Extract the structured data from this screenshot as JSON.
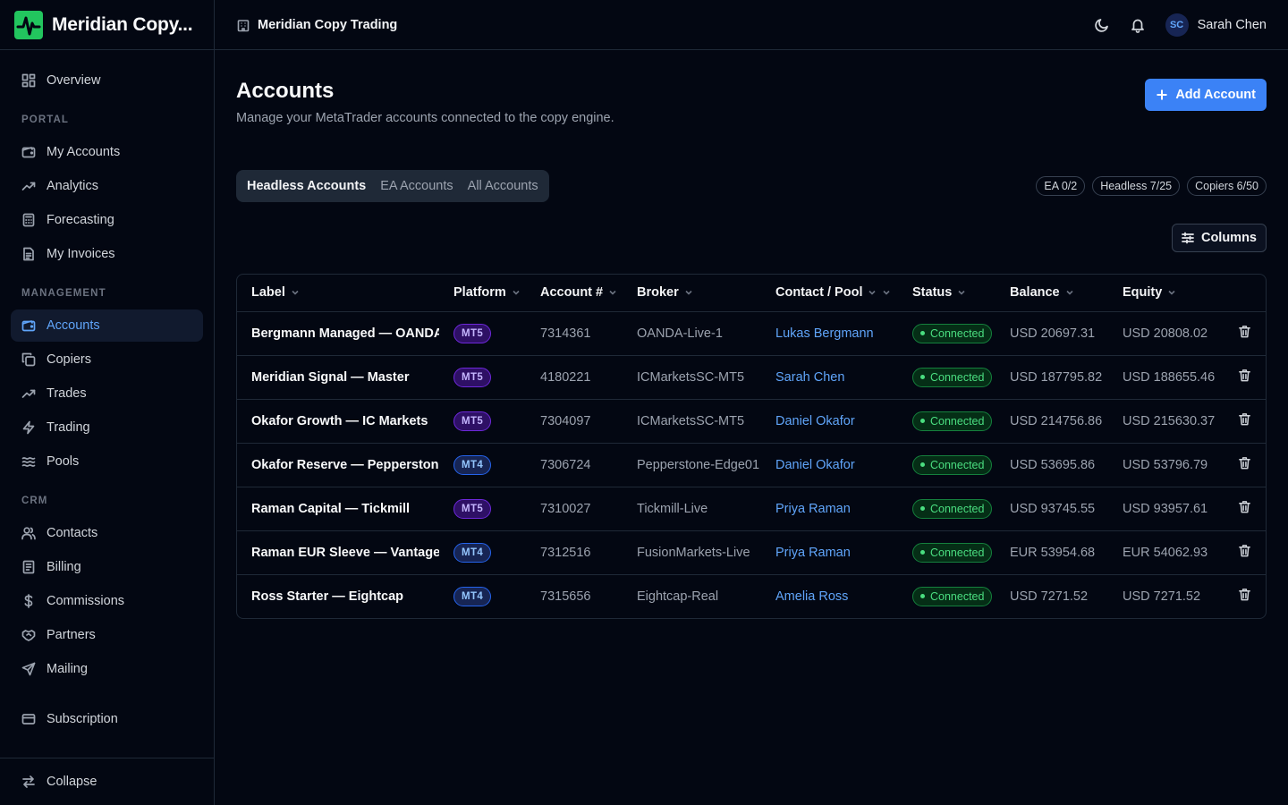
{
  "brand": {
    "name": "Meridian Copy...",
    "accent": "#22c55e"
  },
  "sidebar": {
    "overview": "Overview",
    "sections": {
      "portal": "PORTAL",
      "management": "MANAGEMENT",
      "crm": "CRM"
    },
    "portal_items": [
      {
        "label": "My Accounts",
        "icon": "wallet-icon"
      },
      {
        "label": "Analytics",
        "icon": "trend-icon"
      },
      {
        "label": "Forecasting",
        "icon": "calculator-icon"
      },
      {
        "label": "My Invoices",
        "icon": "file-icon"
      }
    ],
    "management_items": [
      {
        "label": "Accounts",
        "icon": "wallet-icon",
        "active": true
      },
      {
        "label": "Copiers",
        "icon": "copy-icon"
      },
      {
        "label": "Trades",
        "icon": "trend-icon"
      },
      {
        "label": "Trading",
        "icon": "bolt-icon"
      },
      {
        "label": "Pools",
        "icon": "waves-icon"
      }
    ],
    "crm_items": [
      {
        "label": "Contacts",
        "icon": "users-icon"
      },
      {
        "label": "Billing",
        "icon": "receipt-icon"
      },
      {
        "label": "Commissions",
        "icon": "dollar-icon"
      },
      {
        "label": "Partners",
        "icon": "handshake-icon"
      },
      {
        "label": "Mailing",
        "icon": "send-icon"
      }
    ],
    "subscription": "Subscription",
    "collapse": "Collapse"
  },
  "topbar": {
    "title": "Meridian Copy Trading",
    "user_initials": "SC",
    "user_name": "Sarah Chen"
  },
  "page": {
    "title": "Accounts",
    "subtitle": "Manage your MetaTrader accounts connected to the copy engine.",
    "add_button": "Add Account",
    "columns_button": "Columns",
    "tabs": [
      "Headless Accounts",
      "EA Accounts",
      "All Accounts"
    ],
    "active_tab": 0,
    "counters": [
      "EA 0/2",
      "Headless 7/25",
      "Copiers 6/50"
    ]
  },
  "table": {
    "headers": [
      "Label",
      "Platform",
      "Account #",
      "Broker",
      "Contact / Pool",
      "Status",
      "Balance",
      "Equity"
    ],
    "rows": [
      {
        "label": "Bergmann Managed — OANDA",
        "platform": "MT5",
        "account": "7314361",
        "broker": "OANDA-Live-1",
        "contact": "Lukas Bergmann",
        "status": "Connected",
        "balance": "USD 20697.31",
        "equity": "USD 20808.02"
      },
      {
        "label": "Meridian Signal — Master",
        "platform": "MT5",
        "account": "4180221",
        "broker": "ICMarketsSC-MT5",
        "contact": "Sarah Chen",
        "status": "Connected",
        "balance": "USD 187795.82",
        "equity": "USD 188655.46"
      },
      {
        "label": "Okafor Growth — IC Markets",
        "platform": "MT5",
        "account": "7304097",
        "broker": "ICMarketsSC-MT5",
        "contact": "Daniel Okafor",
        "status": "Connected",
        "balance": "USD 214756.86",
        "equity": "USD 215630.37"
      },
      {
        "label": "Okafor Reserve — Pepperstone",
        "platform": "MT4",
        "account": "7306724",
        "broker": "Pepperstone-Edge01",
        "contact": "Daniel Okafor",
        "status": "Connected",
        "balance": "USD 53695.86",
        "equity": "USD 53796.79"
      },
      {
        "label": "Raman Capital — Tickmill",
        "platform": "MT5",
        "account": "7310027",
        "broker": "Tickmill-Live",
        "contact": "Priya Raman",
        "status": "Connected",
        "balance": "USD 93745.55",
        "equity": "USD 93957.61"
      },
      {
        "label": "Raman EUR Sleeve — Vantage",
        "platform": "MT4",
        "account": "7312516",
        "broker": "FusionMarkets-Live",
        "contact": "Priya Raman",
        "status": "Connected",
        "balance": "EUR 53954.68",
        "equity": "EUR 54062.93"
      },
      {
        "label": "Ross Starter — Eightcap",
        "platform": "MT4",
        "account": "7315656",
        "broker": "Eightcap-Real",
        "contact": "Amelia Ross",
        "status": "Connected",
        "balance": "USD 7271.52",
        "equity": "USD 7271.52"
      }
    ]
  }
}
